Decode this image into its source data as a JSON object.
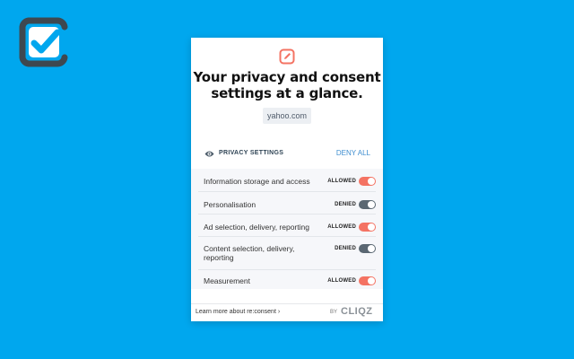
{
  "colors": {
    "background": "#00a7ee",
    "accent": "#f47363",
    "toggle_off": "#5a6772",
    "link": "#3f8ed0"
  },
  "logo": {
    "icon": "checkmark-logo-icon"
  },
  "popup": {
    "icon": "edit-icon",
    "headline_line1": "Your privacy and consent",
    "headline_line2": "settings at a glance.",
    "domain": "yahoo.com",
    "settings_title": "PRIVACY SETTINGS",
    "deny_all": "DENY ALL",
    "items": [
      {
        "label": "Information storage and access",
        "status": "ALLOWED",
        "enabled": true
      },
      {
        "label": "Personalisation",
        "status": "DENIED",
        "enabled": false
      },
      {
        "label": "Ad selection, delivery, reporting",
        "status": "ALLOWED",
        "enabled": true
      },
      {
        "label": "Content selection, delivery, reporting",
        "status": "DENIED",
        "enabled": false
      },
      {
        "label": "Measurement",
        "status": "ALLOWED",
        "enabled": true
      }
    ],
    "learn_more": "Learn more about re:consent ›",
    "by": "BY",
    "brand": "CLIQZ"
  }
}
